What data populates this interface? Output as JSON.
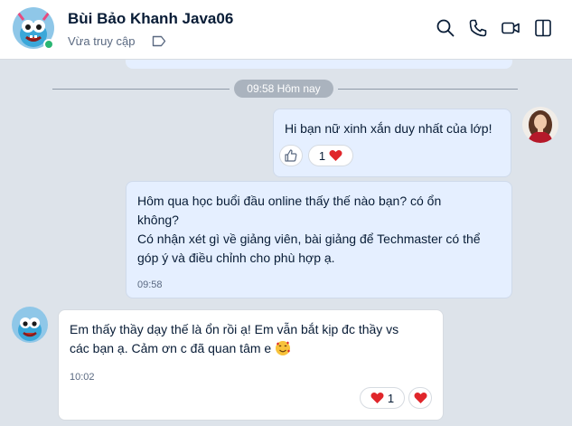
{
  "header": {
    "contact_name": "Bùi Bảo Khanh Java06",
    "status": "Vừa truy cập"
  },
  "chat": {
    "time_divider": "09:58 Hôm nay",
    "messages": [
      {
        "sender": "me",
        "text": "Hi bạn nữ xinh xắn duy nhất của lớp!",
        "reaction_count": "1"
      },
      {
        "sender": "me",
        "text": "Hôm qua học buổi đầu online thấy thế nào bạn? có ổn\nkhông?\nCó nhận xét gì về giảng viên, bài giảng để Techmaster có thể\ngóp ý và điều chỉnh cho phù hợp ạ.",
        "time": "09:58"
      },
      {
        "sender": "them",
        "text": "Em thấy thầy dạy thế là ổn rồi ạ! Em vẫn bắt kịp đc thầy vs\ncác bạn ạ. Cảm ơn c đã quan tâm e",
        "time": "10:02",
        "reaction_count": "1"
      }
    ]
  },
  "colors": {
    "my_bubble": "#e5efff",
    "their_bubble": "#ffffff",
    "heart": "#e0262b",
    "online": "#2bb673",
    "background": "#dde3ea"
  },
  "icons": {
    "header_actions": [
      "search-icon",
      "phone-icon",
      "video-call-icon",
      "sidebar-toggle-icon"
    ],
    "status_tag": "tag-icon",
    "reactions": [
      "like-icon",
      "heart-icon",
      "smiling-face-with-hearts-emoji"
    ]
  }
}
